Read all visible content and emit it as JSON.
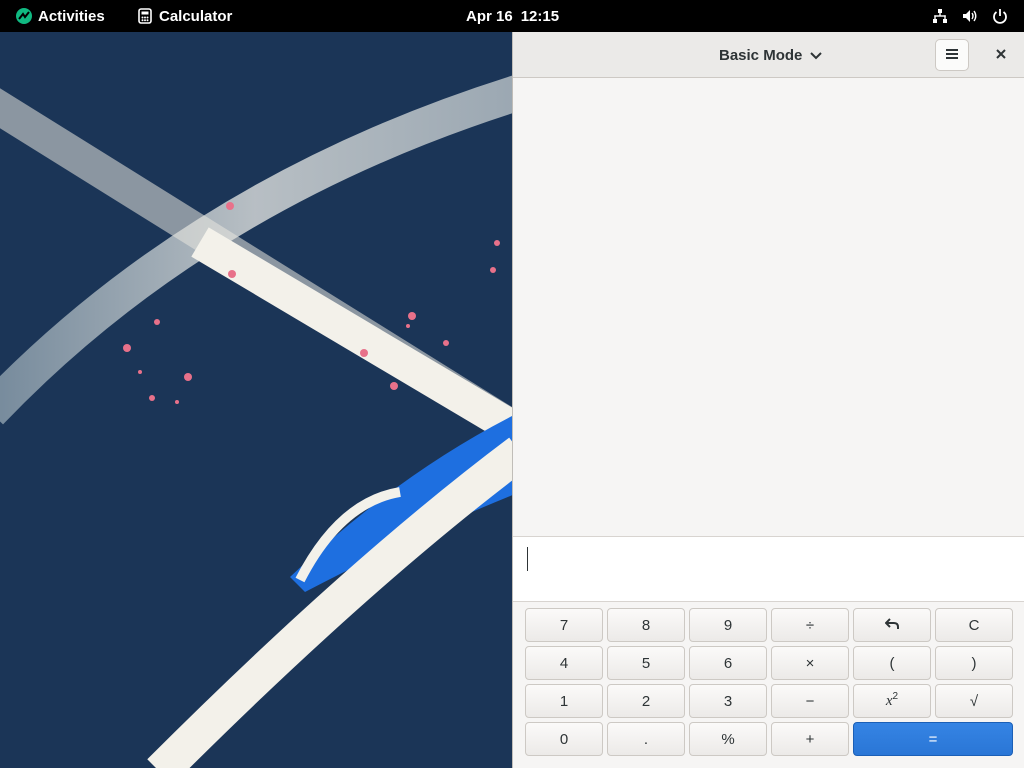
{
  "topbar": {
    "activities_label": "Activities",
    "app_name": "Calculator",
    "date": "Apr 16",
    "time": "12:15",
    "icons": [
      "network-icon",
      "volume-icon",
      "power-icon"
    ]
  },
  "window": {
    "mode_label": "Basic Mode",
    "menu_icon": "hamburger-menu-icon",
    "close_icon": "close-icon",
    "entry_value": ""
  },
  "keypad": {
    "rows": [
      [
        "7",
        "8",
        "9",
        "÷",
        "undo",
        "C"
      ],
      [
        "4",
        "5",
        "6",
        "×",
        "(",
        ")"
      ],
      [
        "1",
        "2",
        "3",
        "−",
        "x²",
        "√"
      ],
      [
        "0",
        ".",
        "%",
        "+",
        "="
      ]
    ],
    "labels": {
      "k7": "7",
      "k8": "8",
      "k9": "9",
      "div": "÷",
      "clear": "C",
      "k4": "4",
      "k5": "5",
      "k6": "6",
      "mul": "×",
      "lparen": "(",
      "rparen": ")",
      "k1": "1",
      "k2": "2",
      "k3": "3",
      "sub": "−",
      "sqrt": "√",
      "k0": "0",
      "dot": ".",
      "percent": "%",
      "add": "+",
      "equals": "=",
      "square_base": "x",
      "square_exp": "2"
    }
  },
  "colors": {
    "accent": "#3584e4",
    "wallpaper_bg": "#1b3557",
    "topbar_bg": "#000000"
  }
}
